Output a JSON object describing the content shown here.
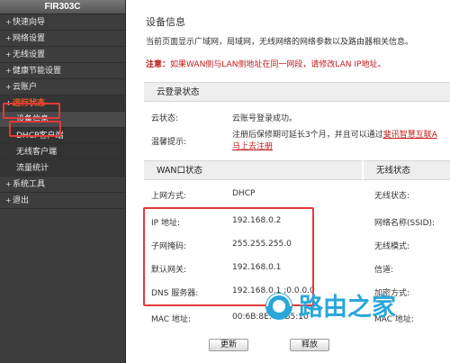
{
  "sidebar": {
    "model": "FIR303C",
    "items": [
      {
        "label": "快速向导"
      },
      {
        "label": "网络设置"
      },
      {
        "label": "无线设置"
      },
      {
        "label": "健康节能设置"
      },
      {
        "label": "云账户"
      },
      {
        "label": "运行状态"
      },
      {
        "label": "设备信息"
      },
      {
        "label": "DHCP客户端"
      },
      {
        "label": "无线客户端"
      },
      {
        "label": "流量统计"
      },
      {
        "label": "系统工具"
      },
      {
        "label": "退出"
      }
    ]
  },
  "main": {
    "title": "设备信息",
    "description": "当前页面显示广域网，局域网，无线网络的网络参数以及路由器相关信息。",
    "note_prefix": "注意：",
    "note_text": "如果WAN侧与LAN侧地址在同一网段，请修改LAN IP地址。",
    "cloud": {
      "header": "云登录状态",
      "status_label": "云状态:",
      "status_value": "云账号登录成功。",
      "tip_label": "温馨提示:",
      "tip_text": "注册后保修期可延长3个月，并且可以通过",
      "tip_link1": "斐讯智慧互联A",
      "tip_link2": "马上去注册"
    },
    "wan": {
      "header": "WAN口状态",
      "rows": [
        {
          "label": "上网方式:",
          "value": "DHCP"
        },
        {
          "label": "IP 地址:",
          "value": "192.168.0.2"
        },
        {
          "label": "子网掩码:",
          "value": "255.255.255.0"
        },
        {
          "label": "默认网关:",
          "value": "192.168.0.1"
        },
        {
          "label": "DNS 服务器:",
          "value": "192.168.0.1 ;0.0.0.0"
        },
        {
          "label": "MAC 地址:",
          "value": "00:6B:8E:73:B5:10"
        }
      ],
      "btn_refresh": "更新",
      "btn_release": "释放"
    },
    "wireless": {
      "header": "无线状态",
      "rows": [
        {
          "label": "无线状态:"
        },
        {
          "label": "网络名称(SSID):"
        },
        {
          "label": "无线模式:"
        },
        {
          "label": "信道:"
        },
        {
          "label": "加密方式:"
        },
        {
          "label": "MAC 地址:"
        }
      ]
    }
  },
  "watermark": {
    "text": "路由之家",
    "color": "#2aa7d8"
  },
  "colors": {
    "highlight_box": "#e23a3a",
    "active_nav": "#ff5a1f",
    "note": "#c11b1b",
    "sidebar_bg": "#3d3d3d"
  }
}
